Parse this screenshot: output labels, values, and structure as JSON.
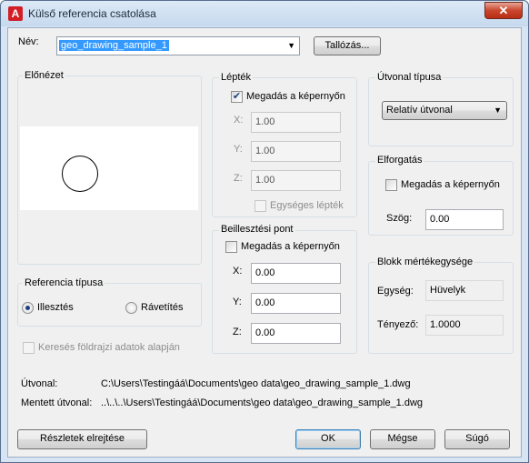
{
  "window": {
    "title": "Külső referencia csatolása",
    "close_label": "✕"
  },
  "name_row": {
    "label": "Név:",
    "value": "geo_drawing_sample_1",
    "browse_label": "Tallózás..."
  },
  "preview": {
    "title": "Előnézet"
  },
  "scale": {
    "title": "Lépték",
    "specify_label": "Megadás a képernyőn",
    "specify_checked": true,
    "x_label": "X:",
    "x_value": "1.00",
    "y_label": "Y:",
    "y_value": "1.00",
    "z_label": "Z:",
    "z_value": "1.00",
    "uniform_label": "Egységes lépték"
  },
  "insertion": {
    "title": "Beillesztési pont",
    "specify_label": "Megadás a képernyőn",
    "x_label": "X:",
    "x_value": "0.00",
    "y_label": "Y:",
    "y_value": "0.00",
    "z_label": "Z:",
    "z_value": "0.00"
  },
  "path_type": {
    "title": "Útvonal típusa",
    "value": "Relatív útvonal"
  },
  "rotation": {
    "title": "Elforgatás",
    "specify_label": "Megadás a képernyőn",
    "angle_label": "Szög:",
    "angle_value": "0.00"
  },
  "block_unit": {
    "title": "Blokk mértékegysége",
    "unit_label": "Egység:",
    "unit_value": "Hüvelyk",
    "factor_label": "Tényező:",
    "factor_value": "1.0000"
  },
  "reference_type": {
    "title": "Referencia típusa",
    "attach_label": "Illesztés",
    "overlay_label": "Rávetítés",
    "selected": "attach"
  },
  "geo_search_label": "Keresés földrajzi adatok alapján",
  "paths": {
    "path_label": "Útvonal:",
    "path_value": "C:\\Users\\Testingáá\\Documents\\geo data\\geo_drawing_sample_1.dwg",
    "saved_label": "Mentett útvonal:",
    "saved_value": "..\\..\\..\\Users\\Testingáá\\Documents\\geo data\\geo_drawing_sample_1.dwg"
  },
  "buttons": {
    "hide_details": "Részletek elrejtése",
    "ok": "OK",
    "cancel": "Mégse",
    "help": "Súgó"
  }
}
